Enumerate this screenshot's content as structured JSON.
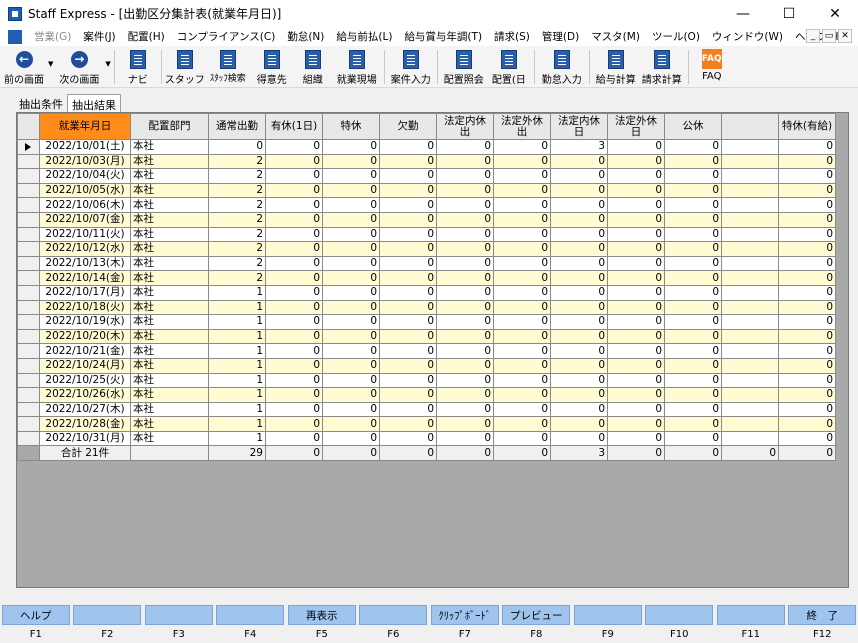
{
  "window": {
    "title": "Staff Express - [出勤区分集計表(就業年月日)]",
    "controls": [
      "—",
      "☐",
      "✕"
    ]
  },
  "menu": {
    "items": [
      "営業(G)",
      "案件(J)",
      "配置(H)",
      "コンプライアンス(C)",
      "勤怠(N)",
      "給与前払(L)",
      "給与賞与年調(T)",
      "請求(S)",
      "管理(D)",
      "マスタ(M)",
      "ツール(O)",
      "ウィンドウ(W)",
      "ヘルプ(H)"
    ],
    "disabled_index": 0,
    "mdi_controls": [
      "_",
      "▭",
      "✕"
    ]
  },
  "toolbar": {
    "prev": "前の画面",
    "next": "次の画面",
    "navi": "ナビ",
    "staff": "スタッフ",
    "staff_search": "ｽﾀｯﾌ検索",
    "client": "得意先",
    "org": "組織",
    "worksite": "就業現場",
    "case_input": "案件入力",
    "placement_inquiry": "配置照会",
    "placement_day": "配置(日",
    "attendance_input": "勤怠入力",
    "payroll_calc": "給与計算",
    "billing_calc": "請求計算",
    "faq": "FAQ",
    "faq_icon": "FAQ"
  },
  "tabs": {
    "conditions": "抽出条件",
    "results": "抽出結果"
  },
  "grid": {
    "headers": [
      "就業年月日",
      "配置部門",
      "通常出勤",
      "有休(1日)",
      "特休",
      "欠勤",
      "法定内休出",
      "法定外休出",
      "法定内休日",
      "法定外休日",
      "公休",
      "",
      "特休(有給)"
    ],
    "rows": [
      [
        "2022/10/01(土)",
        "本社",
        "0",
        "0",
        "0",
        "0",
        "0",
        "0",
        "3",
        "0",
        "0",
        "",
        "0"
      ],
      [
        "2022/10/03(月)",
        "本社",
        "2",
        "0",
        "0",
        "0",
        "0",
        "0",
        "0",
        "0",
        "0",
        "",
        "0"
      ],
      [
        "2022/10/04(火)",
        "本社",
        "2",
        "0",
        "0",
        "0",
        "0",
        "0",
        "0",
        "0",
        "0",
        "",
        "0"
      ],
      [
        "2022/10/05(水)",
        "本社",
        "2",
        "0",
        "0",
        "0",
        "0",
        "0",
        "0",
        "0",
        "0",
        "",
        "0"
      ],
      [
        "2022/10/06(木)",
        "本社",
        "2",
        "0",
        "0",
        "0",
        "0",
        "0",
        "0",
        "0",
        "0",
        "",
        "0"
      ],
      [
        "2022/10/07(金)",
        "本社",
        "2",
        "0",
        "0",
        "0",
        "0",
        "0",
        "0",
        "0",
        "0",
        "",
        "0"
      ],
      [
        "2022/10/11(火)",
        "本社",
        "2",
        "0",
        "0",
        "0",
        "0",
        "0",
        "0",
        "0",
        "0",
        "",
        "0"
      ],
      [
        "2022/10/12(水)",
        "本社",
        "2",
        "0",
        "0",
        "0",
        "0",
        "0",
        "0",
        "0",
        "0",
        "",
        "0"
      ],
      [
        "2022/10/13(木)",
        "本社",
        "2",
        "0",
        "0",
        "0",
        "0",
        "0",
        "0",
        "0",
        "0",
        "",
        "0"
      ],
      [
        "2022/10/14(金)",
        "本社",
        "2",
        "0",
        "0",
        "0",
        "0",
        "0",
        "0",
        "0",
        "0",
        "",
        "0"
      ],
      [
        "2022/10/17(月)",
        "本社",
        "1",
        "0",
        "0",
        "0",
        "0",
        "0",
        "0",
        "0",
        "0",
        "",
        "0"
      ],
      [
        "2022/10/18(火)",
        "本社",
        "1",
        "0",
        "0",
        "0",
        "0",
        "0",
        "0",
        "0",
        "0",
        "",
        "0"
      ],
      [
        "2022/10/19(水)",
        "本社",
        "1",
        "0",
        "0",
        "0",
        "0",
        "0",
        "0",
        "0",
        "0",
        "",
        "0"
      ],
      [
        "2022/10/20(木)",
        "本社",
        "1",
        "0",
        "0",
        "0",
        "0",
        "0",
        "0",
        "0",
        "0",
        "",
        "0"
      ],
      [
        "2022/10/21(金)",
        "本社",
        "1",
        "0",
        "0",
        "0",
        "0",
        "0",
        "0",
        "0",
        "0",
        "",
        "0"
      ],
      [
        "2022/10/24(月)",
        "本社",
        "1",
        "0",
        "0",
        "0",
        "0",
        "0",
        "0",
        "0",
        "0",
        "",
        "0"
      ],
      [
        "2022/10/25(火)",
        "本社",
        "1",
        "0",
        "0",
        "0",
        "0",
        "0",
        "0",
        "0",
        "0",
        "",
        "0"
      ],
      [
        "2022/10/26(水)",
        "本社",
        "1",
        "0",
        "0",
        "0",
        "0",
        "0",
        "0",
        "0",
        "0",
        "",
        "0"
      ],
      [
        "2022/10/27(木)",
        "本社",
        "1",
        "0",
        "0",
        "0",
        "0",
        "0",
        "0",
        "0",
        "0",
        "",
        "0"
      ],
      [
        "2022/10/28(金)",
        "本社",
        "1",
        "0",
        "0",
        "0",
        "0",
        "0",
        "0",
        "0",
        "0",
        "",
        "0"
      ],
      [
        "2022/10/31(月)",
        "本社",
        "1",
        "0",
        "0",
        "0",
        "0",
        "0",
        "0",
        "0",
        "0",
        "",
        "0"
      ]
    ],
    "total": [
      "合計 21件",
      "",
      "29",
      "0",
      "0",
      "0",
      "0",
      "0",
      "3",
      "0",
      "0",
      "0",
      "0"
    ],
    "sorted_column_color": "#ff8c1a",
    "alt_row_color": "#fffbd2"
  },
  "fkeys": [
    {
      "label": "ヘルプ",
      "key": "F1"
    },
    {
      "label": "",
      "key": "F2"
    },
    {
      "label": "",
      "key": "F3"
    },
    {
      "label": "",
      "key": "F4"
    },
    {
      "label": "再表示",
      "key": "F5"
    },
    {
      "label": "",
      "key": "F6"
    },
    {
      "label": "ｸﾘｯﾌﾟﾎﾞｰﾄﾞ",
      "key": "F7"
    },
    {
      "label": "プレビュー",
      "key": "F8"
    },
    {
      "label": "",
      "key": "F9"
    },
    {
      "label": "",
      "key": "F10"
    },
    {
      "label": "",
      "key": "F11"
    },
    {
      "label": "終　了",
      "key": "F12"
    }
  ]
}
